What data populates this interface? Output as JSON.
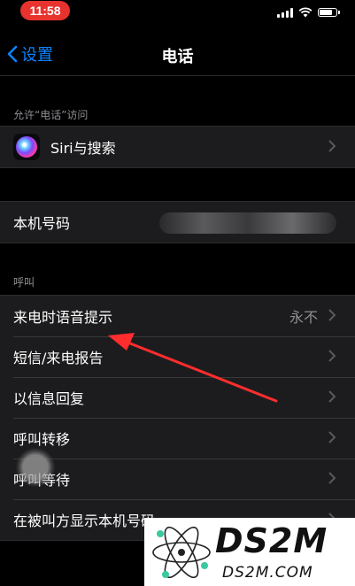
{
  "status_bar": {
    "time": "11:58",
    "battery_level": 0.8,
    "accent": "#e8322e"
  },
  "nav": {
    "back_label": "设置",
    "title": "电话",
    "back_color": "#0a84ff"
  },
  "sections": {
    "allow_access": {
      "header": "允许“电话”访问",
      "items": [
        {
          "label": "Siri与搜索",
          "icon": "siri-icon"
        }
      ]
    },
    "my_number": {
      "label": "本机号码",
      "value": ""
    },
    "calls": {
      "header": "呼叫",
      "items": [
        {
          "label": "来电时语音提示",
          "value": "永不"
        },
        {
          "label": "短信/来电报告"
        },
        {
          "label": "以信息回复"
        },
        {
          "label": "呼叫转移"
        },
        {
          "label": "呼叫等待"
        },
        {
          "label": "在被叫方显示本机号码"
        }
      ]
    }
  },
  "watermark": {
    "brand": "DS2M",
    "url": "DS2M.COM"
  }
}
